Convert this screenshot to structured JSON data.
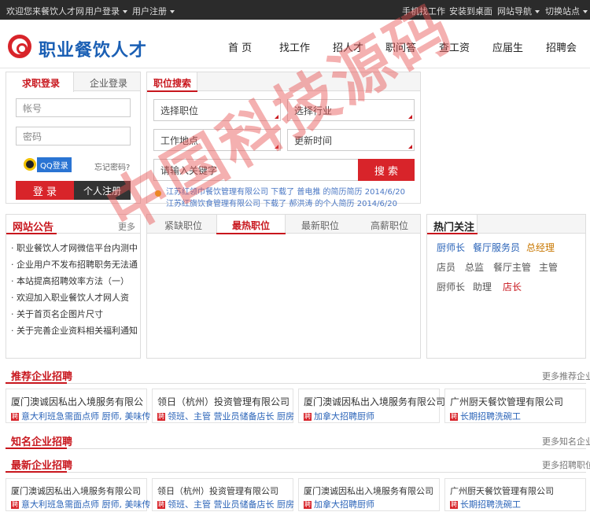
{
  "topbar": {
    "welcome": "欢迎您来餐饮人才网",
    "user_login": "用户登录",
    "user_register": "用户注册",
    "mobile_job": "手机找工作",
    "install_desktop": "安装到桌面",
    "site_nav": "网站导航",
    "switch_site": "切换站点"
  },
  "logo": {
    "text": "职业餐饮人才"
  },
  "nav": [
    "首 页",
    "找工作",
    "招人才",
    "职问答",
    "查工资",
    "应届生",
    "招聘会"
  ],
  "login": {
    "tab_seeker": "求职登录",
    "tab_company": "企业登录",
    "account_placeholder": "帐号",
    "password_placeholder": "密码",
    "qq_login": "QQ登录",
    "forgot": "忘记密码?",
    "login_btn": "登 录",
    "register_btn": "个人注册"
  },
  "search": {
    "title": "职位搜索",
    "position": "选择职位",
    "industry": "选择行业",
    "location": "工作地点",
    "update_time": "更新时间",
    "keyword_placeholder": "请输入关键字",
    "search_btn": "搜 索",
    "ticker": [
      "江苏红领巾餐饮管理有限公司 下载了 普电推 的简历简历 2014/6/20",
      "江苏红旗饮食管理有限公司 下载了 郝洪涛 的个人简历 2014/6/20"
    ]
  },
  "notice": {
    "title": "网站公告",
    "more": "更多",
    "items": [
      "职业餐饮人才网微信平台内测中",
      "企业用户不发布招聘职务无法通",
      "本站提高招聘效率方法（一）",
      "欢迎加入职业餐饮人才网人资",
      "关于首页名企图片尺寸",
      "关于完善企业资料相关福利通知"
    ]
  },
  "jobtabs": [
    "紧缺职位",
    "最热职位",
    "最新职位",
    "高薪职位"
  ],
  "hot": {
    "title": "热门关注",
    "row1": [
      "厨师长",
      "餐厅服务员",
      "总经理"
    ],
    "row2": [
      "店员",
      "总监",
      "餐厅主管",
      "主管"
    ],
    "row3": [
      "厨师长",
      "助理",
      "店长"
    ]
  },
  "recommend": {
    "title": "推荐企业招聘",
    "more": "更多推荐企业",
    "cards": [
      {
        "name": "厦门澳诚因私出入境服务有限公",
        "jobs": "意大利班急需面点师  厨师, 美味传"
      },
      {
        "name": "领日（杭州）投资管理有限公司",
        "jobs": "领班、主管  营业员储备店长  厨房"
      },
      {
        "name": "厦门澳诚因私出入境服务有限公司",
        "jobs": "加拿大招聘厨师"
      },
      {
        "name": "广州厨天餐饮管理有限公司",
        "jobs": "长期招聘洗碗工"
      }
    ]
  },
  "famous": {
    "title": "知名企业招聘",
    "more": "更多知名企业"
  },
  "latest": {
    "title": "最新企业招聘",
    "more": "更多招聘职位",
    "cards": [
      {
        "name": "厦门澳诚因私出入境服务有限公司",
        "jobs": "意大利班急需面点师  厨师, 美味传"
      },
      {
        "name": "领日（杭州）投资管理有限公司",
        "jobs": "领班、主管  营业员储备店长  厨房"
      },
      {
        "name": "厦门澳诚因私出入境服务有限公司",
        "jobs": "加拿大招聘厨师"
      },
      {
        "name": "广州厨天餐饮管理有限公司",
        "jobs": "长期招聘洗碗工"
      }
    ]
  },
  "watermark": "中国科技源码",
  "colors": {
    "brand_red": "#c8161d",
    "logo_blue": "#1a5fb4",
    "topbar": "#2b2b2b"
  }
}
